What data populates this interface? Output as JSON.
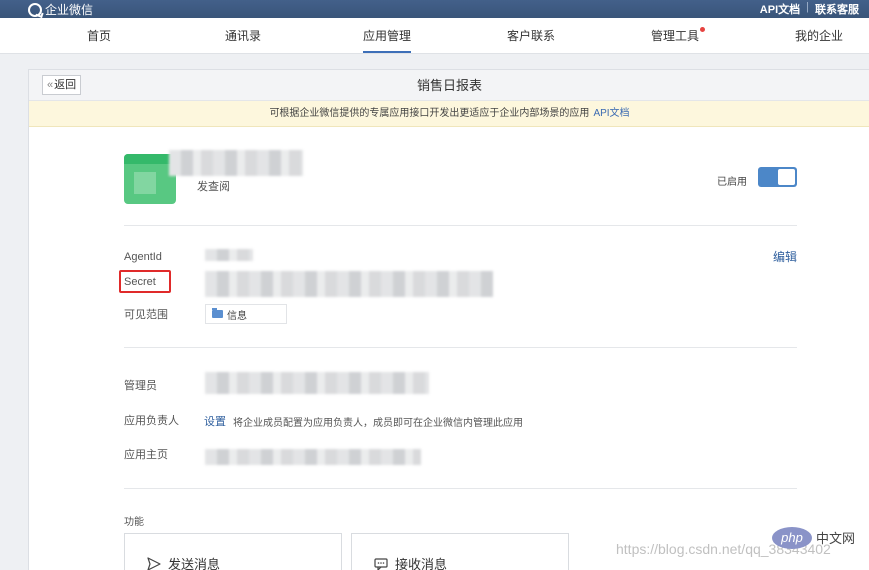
{
  "topbar": {
    "brand": "企业微信",
    "links": [
      "API文档",
      "联系客服"
    ]
  },
  "nav": {
    "items": [
      {
        "label": "首页"
      },
      {
        "label": "通讯录"
      },
      {
        "label": "应用管理",
        "active": true
      },
      {
        "label": "客户联系"
      },
      {
        "label": "管理工具",
        "has_dot": true
      },
      {
        "label": "我的企业"
      }
    ]
  },
  "panel": {
    "back_label": "返回",
    "title": "销售日报表",
    "notice_text": "可根据企业微信提供的专属应用接口开发出更适应于企业内部场景的应用",
    "notice_link": "API文档"
  },
  "app": {
    "subtitle": "发查阅",
    "enabled_label": "已启用",
    "enabled": true
  },
  "details": {
    "agentid_label": "AgentId",
    "secret_label": "Secret",
    "range_label": "可见范围",
    "range_tag": "信息",
    "edit_label": "编辑"
  },
  "management": {
    "admin_label": "管理员",
    "owner_label": "应用负责人",
    "setup_link": "设置",
    "setup_hint": "将企业成员配置为应用负责人，成员即可在企业微信内管理此应用",
    "homepage_label": "应用主页"
  },
  "functions": {
    "section_title": "功能",
    "cards": [
      {
        "label": "发送消息",
        "icon": "send-icon"
      },
      {
        "label": "接收消息",
        "icon": "message-icon"
      }
    ]
  },
  "watermark": {
    "text": "https://blog.csdn.net/qq_38343402",
    "php_logo": "php",
    "php_text": "中文网"
  },
  "colors": {
    "topbar": "#3d5a80",
    "accent": "#3d6fb8",
    "toggle": "#4c87c8",
    "highlight_box": "#e02a2a",
    "notice_bg": "#fdf7dd"
  }
}
